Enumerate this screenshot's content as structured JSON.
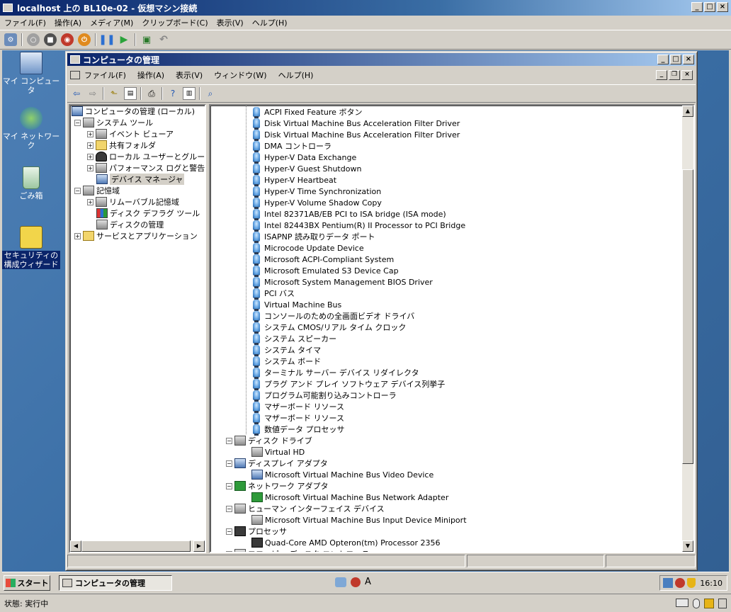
{
  "vm_window": {
    "title": "localhost 上の BL10e-02 - 仮想マシン接続",
    "menu": [
      "ファイル(F)",
      "操作(A)",
      "メディア(M)",
      "クリップボード(C)",
      "表示(V)",
      "ヘルプ(H)"
    ],
    "status_label": "状態: 実行中"
  },
  "desktop_icons": [
    {
      "label": "マイ コンピュータ",
      "icon": "my-computer-icon"
    },
    {
      "label": "マイ ネットワーク",
      "icon": "network-icon"
    },
    {
      "label": "ごみ箱",
      "icon": "recycle-bin-icon"
    },
    {
      "label": "セキュリティの構成ウィザード",
      "icon": "security-wizard-icon"
    }
  ],
  "cm_window": {
    "title": "コンピュータの管理",
    "menu": [
      "ファイル(F)",
      "操作(A)",
      "表示(V)",
      "ウィンドウ(W)",
      "ヘルプ(H)"
    ]
  },
  "tree": {
    "root": "コンピュータの管理 (ローカル)",
    "system_tools": "システム ツール",
    "event_viewer": "イベント ビューア",
    "shared_folders": "共有フォルダ",
    "local_users": "ローカル ユーザーとグループ",
    "perf_logs": "パフォーマンス ログと警告",
    "device_manager": "デバイス マネージャ",
    "storage": "記憶域",
    "removable": "リムーバブル記憶域",
    "defrag": "ディスク デフラグ ツール",
    "disk_mgmt": "ディスクの管理",
    "services_apps": "サービスとアプリケーション"
  },
  "devices": {
    "system_devices": [
      "ACPI Fixed Feature ボタン",
      "Disk Virtual Machine Bus Acceleration Filter Driver",
      "Disk Virtual Machine Bus Acceleration Filter Driver",
      "DMA コントローラ",
      "Hyper-V Data Exchange",
      "Hyper-V Guest Shutdown",
      "Hyper-V Heartbeat",
      "Hyper-V Time Synchronization",
      "Hyper-V Volume Shadow Copy",
      "Intel 82371AB/EB PCI to ISA bridge (ISA mode)",
      "Intel 82443BX Pentium(R) II Processor to PCI Bridge",
      "ISAPNP 読み取りデータ ポート",
      "Microcode Update Device",
      "Microsoft ACPI-Compliant System",
      "Microsoft Emulated S3 Device Cap",
      "Microsoft System Management BIOS Driver",
      "PCI バス",
      "Virtual Machine Bus",
      "コンソールのための全画面ビデオ ドライバ",
      "システム CMOS/リアル タイム クロック",
      "システム スピーカー",
      "システム タイマ",
      "システム ボード",
      "ターミナル サーバー デバイス リダイレクタ",
      "プラグ アンド プレイ ソフトウェア デバイス列挙子",
      "プログラム可能割り込みコントローラ",
      "マザーボード リソース",
      "マザーボード リソース",
      "数値データ プロセッサ"
    ],
    "groups": [
      {
        "label": "ディスク ドライブ",
        "icon": "disk-drive-icon",
        "child": "Virtual HD"
      },
      {
        "label": "ディスプレイ アダプタ",
        "icon": "display-adapter-icon",
        "child": "Microsoft Virtual Machine Bus Video Device"
      },
      {
        "label": "ネットワーク アダプタ",
        "icon": "network-adapter-icon",
        "child": "Microsoft Virtual Machine Bus Network Adapter"
      },
      {
        "label": "ヒューマン インターフェイス デバイス",
        "icon": "hid-icon",
        "child": "Microsoft Virtual Machine Bus Input Device Miniport"
      },
      {
        "label": "プロセッサ",
        "icon": "processor-icon",
        "child": "Quad-Core AMD Opteron(tm) Processor 2356"
      }
    ],
    "partial_last": "フロッピー ディスク コントローラ"
  },
  "taskbar": {
    "start_label": "スタート",
    "active_task": "コンピュータの管理",
    "ime_label": "A",
    "clock": "16:10"
  }
}
